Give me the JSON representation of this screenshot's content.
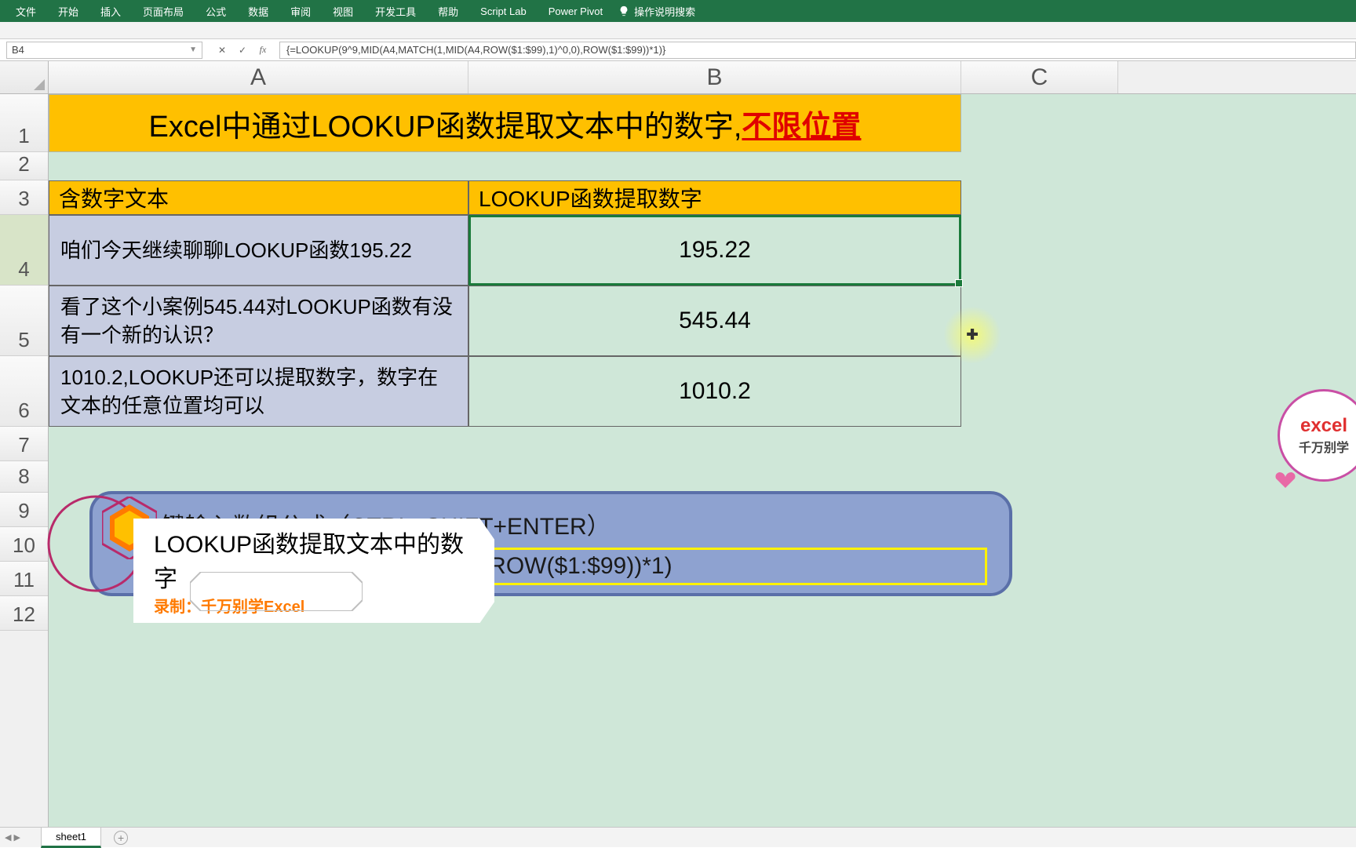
{
  "ribbon": {
    "tabs": [
      "文件",
      "开始",
      "插入",
      "页面布局",
      "公式",
      "数据",
      "审阅",
      "视图",
      "开发工具",
      "帮助",
      "Script Lab",
      "Power Pivot"
    ],
    "search_placeholder": "操作说明搜索"
  },
  "name_box": "B4",
  "formula": "{=LOOKUP(9^9,MID(A4,MATCH(1,MID(A4,ROW($1:$99),1)^0,0),ROW($1:$99))*1)}",
  "columns": [
    "A",
    "B",
    "C"
  ],
  "rows": [
    "1",
    "2",
    "3",
    "4",
    "5",
    "6",
    "7",
    "8",
    "9",
    "10",
    "11",
    "12"
  ],
  "title": {
    "black": "Excel中通过LOOKUP函数提取文本中的数字,",
    "red": "不限位置"
  },
  "headers": {
    "A": "含数字文本",
    "B": "LOOKUP函数提取数字"
  },
  "data": [
    {
      "A": "咱们今天继续聊聊LOOKUP函数195.22",
      "B": "195.22"
    },
    {
      "A": "看了这个小案例545.44对LOOKUP函数有没有一个新的认识？",
      "B": "545.44"
    },
    {
      "A": "1010.2,LOOKUP还可以提取数字，数字在文本的任意位置均可以",
      "B": "1010.2"
    }
  ],
  "callout": {
    "line1_prefix": "键输入数组公式（CTRL+SHIFT+ENTER）",
    "formula_tail": "MID(A4,ROW($1:$99),1)^0,0),ROW($1:$99))*1)"
  },
  "banner": {
    "title": "LOOKUP函数提取文本中的数字",
    "credit": "录制：千万别学Excel"
  },
  "watermark": {
    "t1": "excel",
    "t2": "千万别学"
  },
  "sheet_tab": "sheet1"
}
